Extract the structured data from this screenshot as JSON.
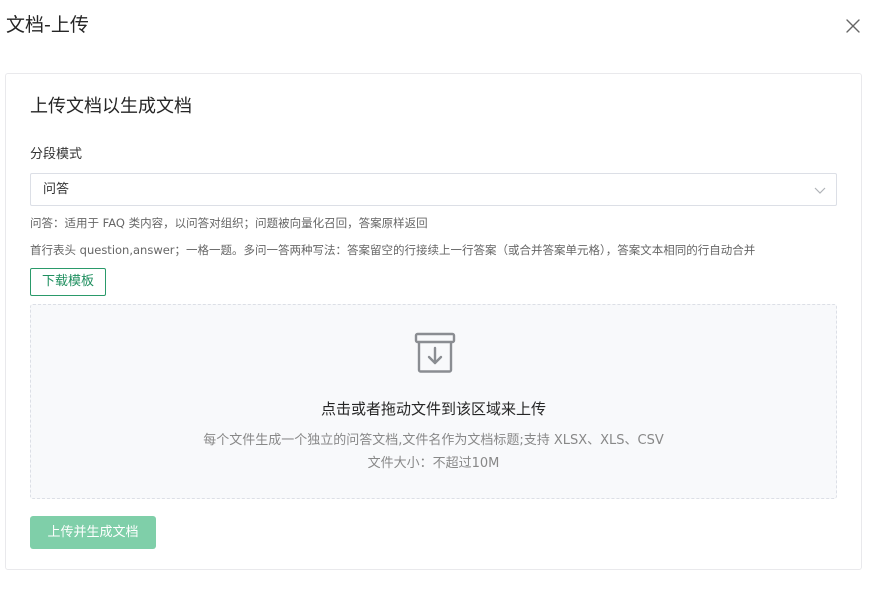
{
  "dialog": {
    "title": "文档-上传",
    "close_icon": "close-icon"
  },
  "card": {
    "title": "上传文档以生成文档",
    "segment_mode": {
      "label": "分段模式",
      "value": "问答",
      "arrow_icon": "chevron-down-icon"
    },
    "hints": [
      "问答：适用于 FAQ 类内容，以问答对组织；问题被向量化召回，答案原样返回",
      "首行表头 question,answer；一格一题。多问一答两种写法：答案留空的行接续上一行答案（或合并答案单元格），答案文本相同的行自动合并"
    ],
    "download_template_label": "下载模板",
    "dropzone": {
      "icon": "archive-download-icon",
      "title": "点击或者拖动文件到该区域来上传",
      "subtitle": "每个文件生成一个独立的问答文档,文件名作为文档标题;支持 XLSX、XLS、CSV",
      "size_limit": "文件大小：不超过10M"
    },
    "submit_label": "上传并生成文档"
  },
  "colors": {
    "accent": "#1f8f5f",
    "accent_disabled": "#7fcfa9",
    "border": "#dcdfe6",
    "dropzone_bg": "#f8f9fb"
  }
}
